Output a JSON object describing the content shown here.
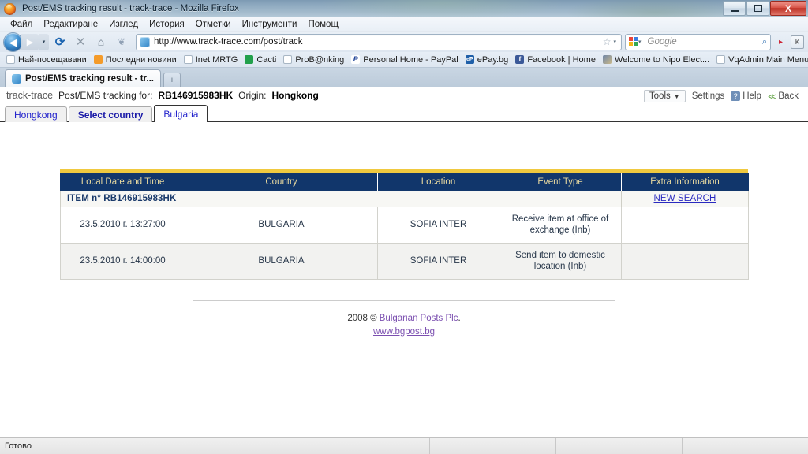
{
  "window": {
    "title": "Post/EMS tracking result - track-trace - Mozilla Firefox",
    "minimize_label": "Minimize",
    "maximize_label": "Maximize",
    "close_label": "X"
  },
  "menubar": {
    "items": [
      "Файл",
      "Редактиране",
      "Изглед",
      "История",
      "Отметки",
      "Инструменти",
      "Помощ"
    ]
  },
  "toolbar": {
    "back_label": "◀",
    "forward_label": "▶",
    "dropdown_label": "▾",
    "reload_label": "⟳",
    "stop_label": "✕",
    "home_label": "⌂",
    "heart_label": "❦",
    "url": "http://www.track-trace.com/post/track",
    "star_label": "☆",
    "url_caret": "▾",
    "search_placeholder": "Google",
    "search_caret": "▾",
    "magnifier_label": "⌕",
    "ext1_label": "K",
    "ext2_label": "K"
  },
  "bookmarks": {
    "items": [
      {
        "label": "Най-посещавани",
        "icon": "most-visited-icon"
      },
      {
        "label": "Последни новини",
        "icon": "rss-icon"
      },
      {
        "label": "Inet MRTG",
        "icon": "page-icon"
      },
      {
        "label": "Cacti",
        "icon": "cacti-icon"
      },
      {
        "label": "ProB@nking",
        "icon": "page-icon"
      },
      {
        "label": "Personal Home - PayPal",
        "icon": "paypal-icon"
      },
      {
        "label": "ePay.bg",
        "icon": "epay-icon"
      },
      {
        "label": "Facebook | Home",
        "icon": "facebook-icon"
      },
      {
        "label": "Welcome to Nipo Elect...",
        "icon": "image-icon"
      },
      {
        "label": "VqAdmin Main Menu",
        "icon": "page-icon"
      }
    ],
    "overflow_label": "»"
  },
  "tabs": {
    "active_tab": "Post/EMS tracking result - tr...",
    "newtab_label": "+"
  },
  "page": {
    "brand": "track-trace",
    "tracking_label": "Post/EMS tracking for:",
    "tracking_number": "RB146915983HK",
    "origin_label": "Origin:",
    "origin_value": "Hongkong",
    "actions": {
      "tools_label": "Tools",
      "tools_caret": "▼",
      "settings_label": "Settings",
      "help_icon_label": "?",
      "help_label": "Help",
      "back_icon_label": "≪",
      "back_label": "Back"
    },
    "country_tabs": [
      {
        "label": "Hongkong",
        "state": "normal"
      },
      {
        "label": "Select country",
        "state": "bold"
      },
      {
        "label": "Bulgaria",
        "state": "active"
      }
    ]
  },
  "result_table": {
    "item_label": "ITEM n° RB146915983HK",
    "new_search_label": "NEW SEARCH",
    "columns": [
      "Local Date and Time",
      "Country",
      "Location",
      "Event Type",
      "Extra Information"
    ],
    "rows": [
      {
        "datetime": "23.5.2010 г. 13:27:00",
        "country": "BULGARIA",
        "location": "SOFIA INTER",
        "event_type": "Receive item at office of exchange (Inb)",
        "extra": ""
      },
      {
        "datetime": "23.5.2010 г. 14:00:00",
        "country": "BULGARIA",
        "location": "SOFIA INTER",
        "event_type": "Send item to domestic location (Inb)",
        "extra": ""
      }
    ]
  },
  "footer": {
    "copyright_prefix": "2008 © ",
    "company_link": "Bulgarian Posts Plc",
    "copyright_suffix": ".",
    "site_link": "www.bgpost.bg"
  },
  "statusbar": {
    "text": "Готово"
  },
  "colors": {
    "table_header_bg": "#11366b",
    "table_header_text": "#e8d9a0",
    "gold_bar": "#f0c93f",
    "item_label_text": "#1a3a6b",
    "link": "#2222cc",
    "footer_link": "#7b4fb0",
    "row_alt_bg": "#f2f2f0"
  }
}
